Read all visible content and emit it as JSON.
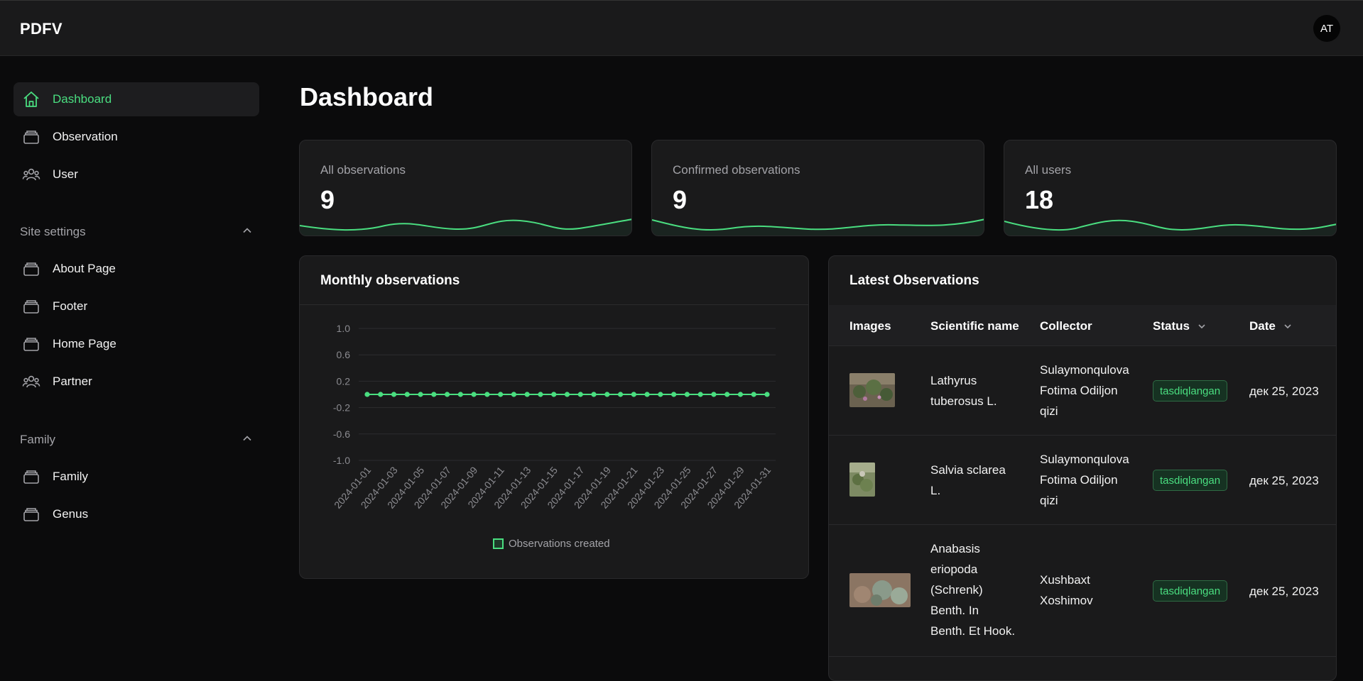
{
  "app": {
    "brand": "PDFV",
    "avatar_initials": "AT",
    "accent": "#4ade80"
  },
  "sidebar": {
    "items": [
      {
        "label": "Dashboard",
        "icon": "home-icon",
        "active": true
      },
      {
        "label": "Observation",
        "icon": "stack-icon"
      },
      {
        "label": "User",
        "icon": "users-icon"
      }
    ],
    "sections": [
      {
        "title": "Site settings",
        "expanded": true,
        "items": [
          {
            "label": "About Page",
            "icon": "stack-icon"
          },
          {
            "label": "Footer",
            "icon": "stack-icon"
          },
          {
            "label": "Home Page",
            "icon": "stack-icon"
          },
          {
            "label": "Partner",
            "icon": "users-icon"
          }
        ]
      },
      {
        "title": "Family",
        "expanded": true,
        "items": [
          {
            "label": "Family",
            "icon": "stack-icon"
          },
          {
            "label": "Genus",
            "icon": "stack-icon"
          }
        ]
      }
    ]
  },
  "page": {
    "title": "Dashboard"
  },
  "stats": [
    {
      "label": "All observations",
      "value": "9"
    },
    {
      "label": "Confirmed observations",
      "value": "9"
    },
    {
      "label": "All users",
      "value": "18"
    }
  ],
  "monthly": {
    "title": "Monthly observations",
    "legend_label": "Observations created"
  },
  "chart_data": {
    "type": "line",
    "x": [
      "2024-01-01",
      "2024-01-02",
      "2024-01-03",
      "2024-01-04",
      "2024-01-05",
      "2024-01-06",
      "2024-01-07",
      "2024-01-08",
      "2024-01-09",
      "2024-01-10",
      "2024-01-11",
      "2024-01-12",
      "2024-01-13",
      "2024-01-14",
      "2024-01-15",
      "2024-01-16",
      "2024-01-17",
      "2024-01-18",
      "2024-01-19",
      "2024-01-20",
      "2024-01-21",
      "2024-01-22",
      "2024-01-23",
      "2024-01-24",
      "2024-01-25",
      "2024-01-26",
      "2024-01-27",
      "2024-01-28",
      "2024-01-29",
      "2024-01-30",
      "2024-01-31"
    ],
    "x_tick_labels": [
      "2024-01-01",
      "2024-01-03",
      "2024-01-05",
      "2024-01-07",
      "2024-01-09",
      "2024-01-11",
      "2024-01-13",
      "2024-01-15",
      "2024-01-17",
      "2024-01-19",
      "2024-01-21",
      "2024-01-23",
      "2024-01-25",
      "2024-01-27",
      "2024-01-29",
      "2024-01-31"
    ],
    "y_ticks": [
      "1.0",
      "0.6",
      "0.2",
      "-0.2",
      "-0.6",
      "-1.0"
    ],
    "ylim": [
      -1,
      1
    ],
    "series": [
      {
        "name": "Observations created",
        "color": "#4ade80",
        "values": [
          0,
          0,
          0,
          0,
          0,
          0,
          0,
          0,
          0,
          0,
          0,
          0,
          0,
          0,
          0,
          0,
          0,
          0,
          0,
          0,
          0,
          0,
          0,
          0,
          0,
          0,
          0,
          0,
          0,
          0,
          0
        ]
      }
    ],
    "title": "",
    "xlabel": "",
    "ylabel": "",
    "grid": true,
    "legend": "bottom"
  },
  "latest": {
    "title": "Latest Observations",
    "columns": [
      "Images",
      "Scientific name",
      "Collector",
      "Status",
      "Date"
    ],
    "rows": [
      {
        "name_lines": [
          "Lathyrus",
          "tuberosus L."
        ],
        "collector_lines": [
          "Sulaymonqulova",
          "Fotima Odiljon",
          "qizi"
        ],
        "status": "tasdiqlangan",
        "date": "дек 25, 2023",
        "image": "plant-photo-1"
      },
      {
        "name_lines": [
          "Salvia sclarea",
          "L."
        ],
        "collector_lines": [
          "Sulaymonqulova",
          "Fotima Odiljon",
          "qizi"
        ],
        "status": "tasdiqlangan",
        "date": "дек 25, 2023",
        "image": "plant-photo-2"
      },
      {
        "name_lines": [
          "Anabasis",
          "eriopoda",
          "(Schrenk)",
          "Benth. In",
          "Benth. Et Hook."
        ],
        "collector_lines": [
          "Xushbaxt",
          "Xoshimov"
        ],
        "status": "tasdiqlangan",
        "date": "дек 25, 2023",
        "image": "plant-photo-3"
      }
    ]
  }
}
